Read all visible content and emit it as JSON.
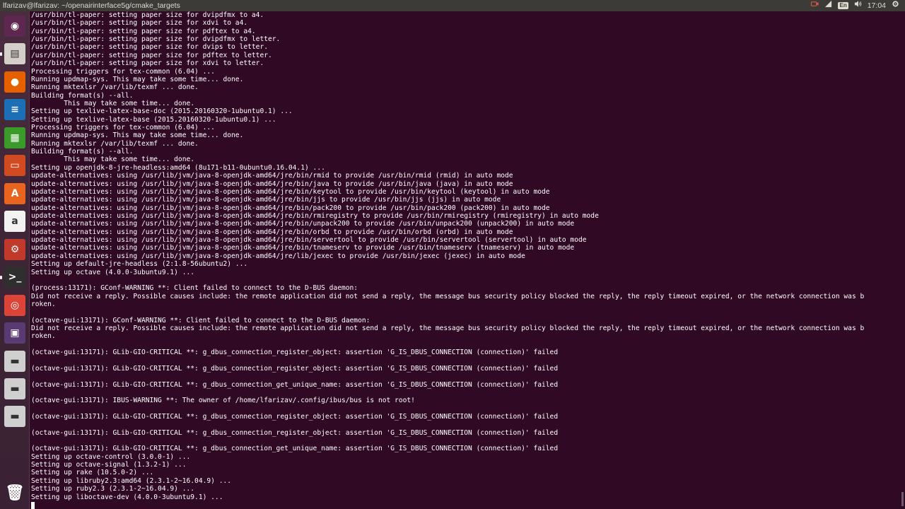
{
  "window": {
    "title": "lfarizav@lfarizav: ~/openairinterface5g/cmake_targets"
  },
  "tray": {
    "keyboard_layout": "En",
    "clock": "17:04"
  },
  "launcher": {
    "items": [
      {
        "name": "dash-home",
        "glyph": "◉",
        "color": "#5e2750"
      },
      {
        "name": "files",
        "glyph": "▤",
        "color": "#d5cfc9"
      },
      {
        "name": "firefox",
        "glyph": "●",
        "color": "#e66000"
      },
      {
        "name": "writer",
        "glyph": "≡",
        "color": "#1c6fb5"
      },
      {
        "name": "calc",
        "glyph": "▦",
        "color": "#3a9b2a"
      },
      {
        "name": "impress",
        "glyph": "▭",
        "color": "#d24a1f"
      },
      {
        "name": "software-center",
        "glyph": "A",
        "color": "#e9641e"
      },
      {
        "name": "amazon",
        "glyph": "a",
        "color": "#f2f2f2"
      },
      {
        "name": "system-settings",
        "glyph": "⚙",
        "color": "#c0392b"
      },
      {
        "name": "terminal",
        "glyph": ">_",
        "color": "#2f2f2f"
      },
      {
        "name": "chrome",
        "glyph": "◎",
        "color": "#db4437"
      },
      {
        "name": "media-player",
        "glyph": "▣",
        "color": "#5a3a72"
      },
      {
        "name": "drive-1",
        "glyph": "▬",
        "color": "#cfcfcf"
      },
      {
        "name": "drive-2",
        "glyph": "▬",
        "color": "#cfcfcf"
      },
      {
        "name": "drive-3",
        "glyph": "▬",
        "color": "#cfcfcf"
      }
    ],
    "trash": {
      "name": "trash",
      "glyph": "🗑"
    }
  },
  "terminal": {
    "lines": [
      "/usr/bin/tl-paper: setting paper size for dvipdfmx to a4.",
      "/usr/bin/tl-paper: setting paper size for xdvi to a4.",
      "/usr/bin/tl-paper: setting paper size for pdftex to a4.",
      "/usr/bin/tl-paper: setting paper size for dvipdfmx to letter.",
      "/usr/bin/tl-paper: setting paper size for dvips to letter.",
      "/usr/bin/tl-paper: setting paper size for pdftex to letter.",
      "/usr/bin/tl-paper: setting paper size for xdvi to letter.",
      "Processing triggers for tex-common (6.04) ...",
      "Running updmap-sys. This may take some time... done.",
      "Running mktexlsr /var/lib/texmf ... done.",
      "Building format(s) --all.",
      "        This may take some time... done.",
      "Setting up texlive-latex-base-doc (2015.20160320-1ubuntu0.1) ...",
      "Setting up texlive-latex-base (2015.20160320-1ubuntu0.1) ...",
      "Processing triggers for tex-common (6.04) ...",
      "Running updmap-sys. This may take some time... done.",
      "Running mktexlsr /var/lib/texmf ... done.",
      "Building format(s) --all.",
      "        This may take some time... done.",
      "Setting up openjdk-8-jre-headless:amd64 (8u171-b11-0ubuntu0.16.04.1) ...",
      "update-alternatives: using /usr/lib/jvm/java-8-openjdk-amd64/jre/bin/rmid to provide /usr/bin/rmid (rmid) in auto mode",
      "update-alternatives: using /usr/lib/jvm/java-8-openjdk-amd64/jre/bin/java to provide /usr/bin/java (java) in auto mode",
      "update-alternatives: using /usr/lib/jvm/java-8-openjdk-amd64/jre/bin/keytool to provide /usr/bin/keytool (keytool) in auto mode",
      "update-alternatives: using /usr/lib/jvm/java-8-openjdk-amd64/jre/bin/jjs to provide /usr/bin/jjs (jjs) in auto mode",
      "update-alternatives: using /usr/lib/jvm/java-8-openjdk-amd64/jre/bin/pack200 to provide /usr/bin/pack200 (pack200) in auto mode",
      "update-alternatives: using /usr/lib/jvm/java-8-openjdk-amd64/jre/bin/rmiregistry to provide /usr/bin/rmiregistry (rmiregistry) in auto mode",
      "update-alternatives: using /usr/lib/jvm/java-8-openjdk-amd64/jre/bin/unpack200 to provide /usr/bin/unpack200 (unpack200) in auto mode",
      "update-alternatives: using /usr/lib/jvm/java-8-openjdk-amd64/jre/bin/orbd to provide /usr/bin/orbd (orbd) in auto mode",
      "update-alternatives: using /usr/lib/jvm/java-8-openjdk-amd64/jre/bin/servertool to provide /usr/bin/servertool (servertool) in auto mode",
      "update-alternatives: using /usr/lib/jvm/java-8-openjdk-amd64/jre/bin/tnameserv to provide /usr/bin/tnameserv (tnameserv) in auto mode",
      "update-alternatives: using /usr/lib/jvm/java-8-openjdk-amd64/jre/lib/jexec to provide /usr/bin/jexec (jexec) in auto mode",
      "Setting up default-jre-headless (2:1.8-56ubuntu2) ...",
      "Setting up octave (4.0.0-3ubuntu9.1) ...",
      "",
      "(process:13171): GConf-WARNING **: Client failed to connect to the D-BUS daemon:",
      "Did not receive a reply. Possible causes include: the remote application did not send a reply, the message bus security policy blocked the reply, the reply timeout expired, or the network connection was b",
      "roken.",
      "",
      "(octave-gui:13171): GConf-WARNING **: Client failed to connect to the D-BUS daemon:",
      "Did not receive a reply. Possible causes include: the remote application did not send a reply, the message bus security policy blocked the reply, the reply timeout expired, or the network connection was b",
      "roken.",
      "",
      "(octave-gui:13171): GLib-GIO-CRITICAL **: g_dbus_connection_register_object: assertion 'G_IS_DBUS_CONNECTION (connection)' failed",
      "",
      "(octave-gui:13171): GLib-GIO-CRITICAL **: g_dbus_connection_register_object: assertion 'G_IS_DBUS_CONNECTION (connection)' failed",
      "",
      "(octave-gui:13171): GLib-GIO-CRITICAL **: g_dbus_connection_get_unique_name: assertion 'G_IS_DBUS_CONNECTION (connection)' failed",
      "",
      "(octave-gui:13171): IBUS-WARNING **: The owner of /home/lfarizav/.config/ibus/bus is not root!",
      "",
      "(octave-gui:13171): GLib-GIO-CRITICAL **: g_dbus_connection_register_object: assertion 'G_IS_DBUS_CONNECTION (connection)' failed",
      "",
      "(octave-gui:13171): GLib-GIO-CRITICAL **: g_dbus_connection_register_object: assertion 'G_IS_DBUS_CONNECTION (connection)' failed",
      "",
      "(octave-gui:13171): GLib-GIO-CRITICAL **: g_dbus_connection_get_unique_name: assertion 'G_IS_DBUS_CONNECTION (connection)' failed",
      "Setting up octave-control (3.0.0-1) ...",
      "Setting up octave-signal (1.3.2-1) ...",
      "Setting up rake (10.5.0-2) ...",
      "Setting up libruby2.3:amd64 (2.3.1-2~16.04.9) ...",
      "Setting up ruby2.3 (2.3.1-2~16.04.9) ...",
      "Setting up liboctave-dev (4.0.0-3ubuntu9.1) ..."
    ]
  }
}
